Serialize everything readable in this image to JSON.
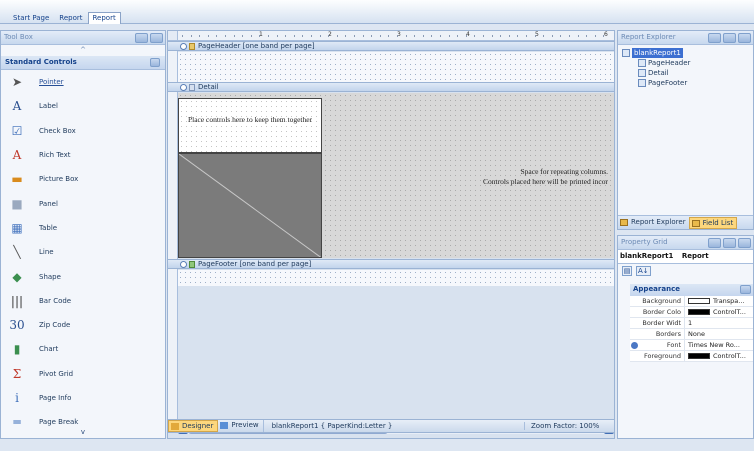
{
  "tabs": [
    {
      "label": "Start Page",
      "active": false
    },
    {
      "label": "Report",
      "active": false
    },
    {
      "label": "Report",
      "active": true
    }
  ],
  "toolbox": {
    "title": "Tool Box",
    "category": "Standard Controls",
    "scroll_up": "^",
    "scroll_down": "v",
    "items": [
      {
        "label": "Pointer",
        "icon": "pointer-icon",
        "glyph": "➤",
        "color": "#555555"
      },
      {
        "label": "Label",
        "icon": "label-icon",
        "glyph": "A",
        "color": "#2a4f8f"
      },
      {
        "label": "Check Box",
        "icon": "checkbox-icon",
        "glyph": "☑",
        "color": "#3a6cb8"
      },
      {
        "label": "Rich Text",
        "icon": "richtext-icon",
        "glyph": "A",
        "color": "#c0392b"
      },
      {
        "label": "Picture Box",
        "icon": "picturebox-icon",
        "glyph": "▬",
        "color": "#d98b1d"
      },
      {
        "label": "Panel",
        "icon": "panel-icon",
        "glyph": "■",
        "color": "#9aa9bf"
      },
      {
        "label": "Table",
        "icon": "table-icon",
        "glyph": "▦",
        "color": "#4a78c0"
      },
      {
        "label": "Line",
        "icon": "line-icon",
        "glyph": "╲",
        "color": "#555555"
      },
      {
        "label": "Shape",
        "icon": "shape-icon",
        "glyph": "◆",
        "color": "#3b8f4f"
      },
      {
        "label": "Bar Code",
        "icon": "barcode-icon",
        "glyph": "|||",
        "color": "#333333"
      },
      {
        "label": "Zip Code",
        "icon": "zipcode-icon",
        "glyph": "30",
        "color": "#2a4f8f"
      },
      {
        "label": "Chart",
        "icon": "chart-icon",
        "glyph": "▮",
        "color": "#3b8f4f"
      },
      {
        "label": "Pivot Grid",
        "icon": "pivotgrid-icon",
        "glyph": "Σ",
        "color": "#c0392b"
      },
      {
        "label": "Page Info",
        "icon": "pageinfo-icon",
        "glyph": "i",
        "color": "#3a6cb8"
      },
      {
        "label": "Page Break",
        "icon": "pagebreak-icon",
        "glyph": "═",
        "color": "#3a6cb8"
      }
    ]
  },
  "designer": {
    "ruler_numbers": [
      "1",
      "2",
      "3",
      "4",
      "5",
      "6"
    ],
    "bands": {
      "page_header": "PageHeader [one band per page]",
      "detail": "Detail",
      "page_footer": "PageFooter [one band per page]"
    },
    "placeholder_text": "Place controls here to keep them together",
    "repeat_text_line1": "Space for repeating columns.",
    "repeat_text_line2": "Controls placed here will be printed incor"
  },
  "status": {
    "designer_tab": "Designer",
    "preview_tab": "Preview",
    "info": "blankReport1 { PaperKind:Letter }",
    "zoom": "Zoom Factor: 100%"
  },
  "explorer": {
    "title": "Report Explorer",
    "nodes": [
      {
        "label": "blankReport1",
        "level": 0,
        "selected": true
      },
      {
        "label": "PageHeader",
        "level": 1,
        "selected": false
      },
      {
        "label": "Detail",
        "level": 1,
        "selected": false
      },
      {
        "label": "PageFooter",
        "level": 1,
        "selected": false
      }
    ],
    "bottom_tabs": [
      {
        "label": "Report Explorer",
        "active": false
      },
      {
        "label": "Field List",
        "active": true
      }
    ]
  },
  "property_grid": {
    "title": "Property Grid",
    "object_name": "blankReport1",
    "object_type": "Report",
    "sort_icon": "A↓",
    "category": "Appearance",
    "rows": [
      {
        "name": "Background",
        "value": "Transpa...",
        "swatch": "#ffffff",
        "expand": false
      },
      {
        "name": "Border Colo",
        "value": "ControlT...",
        "swatch": "#000000",
        "expand": false
      },
      {
        "name": "Border Widt",
        "value": "1",
        "swatch": "",
        "expand": false
      },
      {
        "name": "Borders",
        "value": "None",
        "swatch": "",
        "expand": false
      },
      {
        "name": "Font",
        "value": "Times New Ro...",
        "swatch": "",
        "expand": true
      },
      {
        "name": "Foreground",
        "value": "ControlT...",
        "swatch": "#000000",
        "expand": false
      }
    ]
  }
}
